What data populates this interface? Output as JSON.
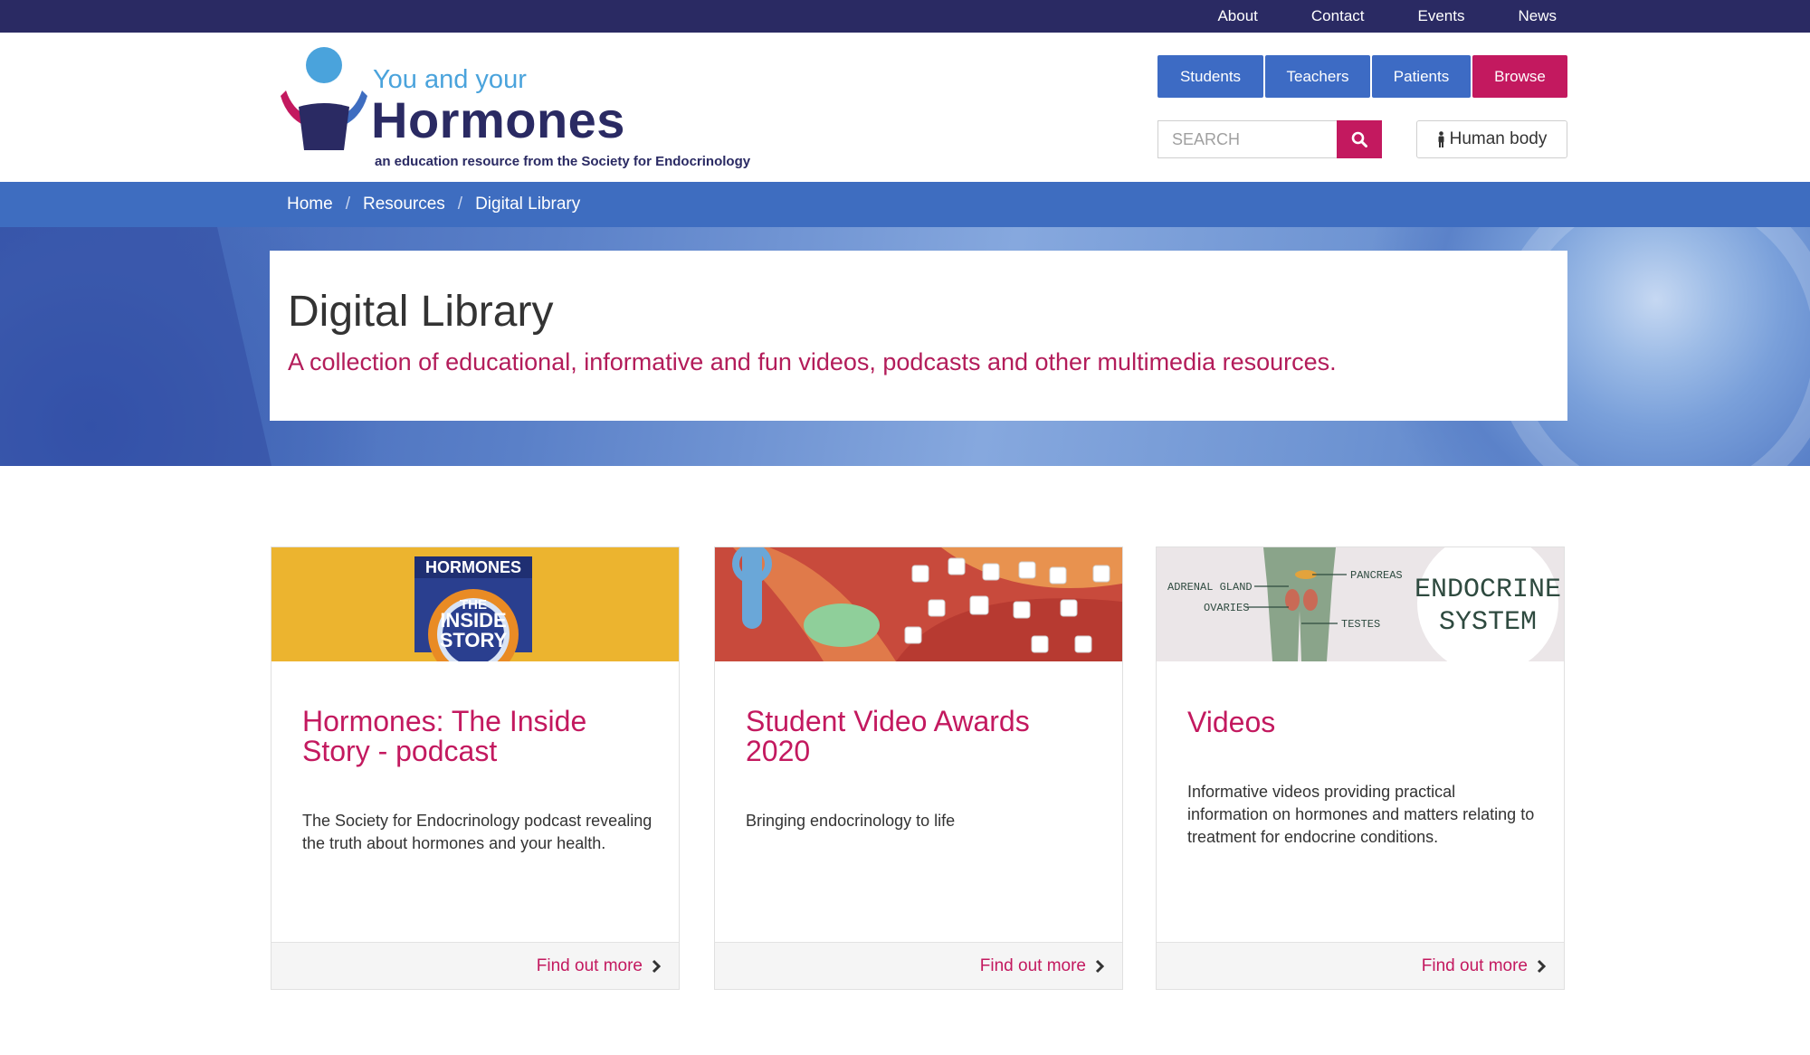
{
  "topnav": {
    "links": [
      "About",
      "Contact",
      "Events",
      "News"
    ]
  },
  "logo": {
    "line1": "You and your",
    "line2": "Hormones",
    "tagline": "an education resource from the Society for Endocrinology"
  },
  "audience_buttons": [
    "Students",
    "Teachers",
    "Patients",
    "Browse"
  ],
  "search": {
    "placeholder": "SEARCH"
  },
  "human_body_button": "Human body",
  "breadcrumb": [
    "Home",
    "Resources",
    "Digital Library"
  ],
  "hero": {
    "title": "Digital Library",
    "subtitle": "A collection of educational, informative and fun videos, podcasts and other multimedia resources."
  },
  "cards": [
    {
      "title": "Hormones: The Inside Story - podcast",
      "description": "The Society for Endocrinology podcast revealing the truth about hormones and your health.",
      "link": "Find out more",
      "thumb_text": [
        "HORMONES",
        "THE",
        "INSIDE",
        "STORY"
      ]
    },
    {
      "title": "Student Video Awards 2020",
      "description": "Bringing endocrinology to life",
      "link": "Find out more"
    },
    {
      "title": "Videos",
      "description": "Informative videos providing practical information on hormones and matters relating to treatment for endocrine conditions.",
      "link": "Find out more",
      "thumb_labels": [
        "ADRENAL GLAND",
        "OVARIES",
        "PANCREAS",
        "TESTES"
      ],
      "thumb_badge": [
        "ENDOCRINE",
        "SYSTEM"
      ]
    }
  ],
  "colors": {
    "navy": "#2a2a63",
    "blue": "#3d6bc4",
    "magenta": "#c3195f",
    "podcast_yellow": "#ecb42f"
  }
}
